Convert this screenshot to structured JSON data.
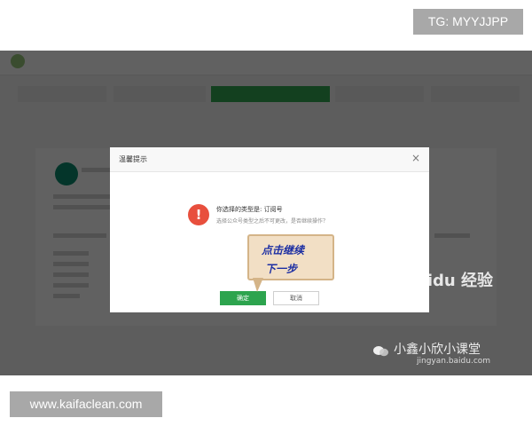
{
  "tags": {
    "top_right": "TG: MYYJJPP",
    "bottom_left": "www.kaifaclean.com"
  },
  "dialog": {
    "title": "温馨提示",
    "message": "你选择的类型是: 订阅号",
    "sub_message": "选择公众号类型之后不可更改，是否继续操作？",
    "confirm_label": "确定",
    "cancel_label": "取消",
    "close_glyph": "×"
  },
  "callout": {
    "line1": "点击继续",
    "line2": "下一步"
  },
  "watermark": {
    "baidu": "Baidu 经验",
    "wechat": "小鑫小欣小课堂",
    "site": "jingyan.baidu.com"
  },
  "colors": {
    "accent_green": "#2da44e",
    "warning_red": "#e84f3d",
    "callout_text": "#1d2fa3",
    "callout_bg": "#f2dfc5"
  }
}
